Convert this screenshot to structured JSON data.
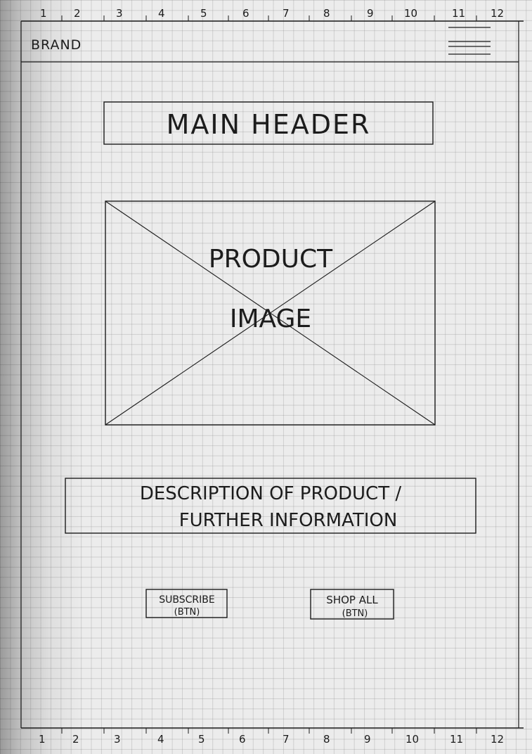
{
  "sketch": {
    "brand": "BRAND",
    "main_header": "MAIN HEADER",
    "product_image": {
      "line1": "PRODUCT",
      "line2": "IMAGE"
    },
    "description": {
      "line1": "DESCRIPTION OF PRODUCT /",
      "line2": "FURTHER INFORMATION"
    },
    "buttons": {
      "subscribe": {
        "label": "SUBSCRIBE",
        "sub": "(BTN)"
      },
      "shop_all": {
        "label": "SHOP ALL",
        "sub": "(BTN)"
      }
    },
    "ruler_top": [
      "1",
      "2",
      "3",
      "4",
      "5",
      "6",
      "7",
      "8",
      "9",
      "10",
      "11",
      "12"
    ],
    "ruler_bottom": [
      "1",
      "2",
      "3",
      "4",
      "5",
      "6",
      "7",
      "8",
      "9",
      "10",
      "11",
      "12"
    ]
  }
}
